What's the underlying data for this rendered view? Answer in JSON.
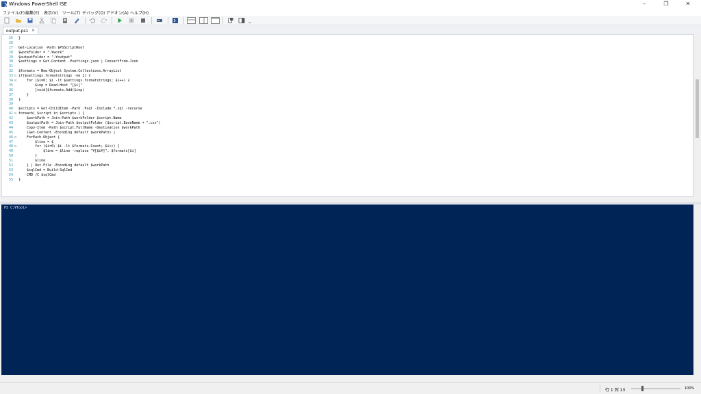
{
  "window": {
    "title": "Windows PowerShell ISE",
    "minimize": "–",
    "maximize": "❐",
    "close": "✕"
  },
  "menu": [
    "ファイル(F)",
    "編集(E)",
    "表示(V)",
    "ツール(T)",
    "デバッグ(D)",
    "アドオン(A)",
    "ヘルプ(H)"
  ],
  "tab": {
    "label": "output.ps1",
    "close": "✕"
  },
  "editor": {
    "lines": [
      {
        "n": "25",
        "fold": "",
        "text": "}"
      },
      {
        "n": "26",
        "fold": "",
        "text": ""
      },
      {
        "n": "27",
        "fold": "",
        "text": "Get-Location -Path $PSScriptRoot"
      },
      {
        "n": "28",
        "fold": "",
        "text": "$workFolder = \".¥work\""
      },
      {
        "n": "29",
        "fold": "",
        "text": "$outputFolder = \".¥output\""
      },
      {
        "n": "30",
        "fold": "",
        "text": "$settings = Get-Content .¥settings.json | ConvertFrom-Json"
      },
      {
        "n": "31",
        "fold": "",
        "text": ""
      },
      {
        "n": "32",
        "fold": "",
        "text": "$formats = New-Object System.Collections.ArrayList"
      },
      {
        "n": "33",
        "fold": "⊟",
        "text": "if($settings.formatstrings -ne 1) {"
      },
      {
        "n": "34",
        "fold": "⊟",
        "text": "    for ($i=0; $i -lt $settings.formatstrings; $i++) {"
      },
      {
        "n": "35",
        "fold": "",
        "text": "        $inp = Read-Host \"[$i]\""
      },
      {
        "n": "36",
        "fold": "",
        "text": "        [void]$formats.Add($inp)"
      },
      {
        "n": "37",
        "fold": "",
        "text": "    }"
      },
      {
        "n": "38",
        "fold": "",
        "text": "}"
      },
      {
        "n": "39",
        "fold": "",
        "text": ""
      },
      {
        "n": "40",
        "fold": "",
        "text": "$scripts = Get-ChildItem -Path .¥sql -Include *.sql -recurse"
      },
      {
        "n": "41",
        "fold": "⊟",
        "text": "foreach( $script in $scripts ) {"
      },
      {
        "n": "42",
        "fold": "",
        "text": "    $workPath = Join-Path $workFolder $script.Name"
      },
      {
        "n": "43",
        "fold": "",
        "text": "    $outputPath = Join-Path $outputFolder ($script.BaseName + \".csv\")"
      },
      {
        "n": "44",
        "fold": "",
        "text": "    Copy-Item -Path $script.FullName -Destination $workPath"
      },
      {
        "n": "45",
        "fold": "",
        "text": "    (Get-Content -Encoding default $workPath) |"
      },
      {
        "n": "46",
        "fold": "⊟",
        "text": "    ForEach-Object {"
      },
      {
        "n": "47",
        "fold": "",
        "text": "        $line = $_"
      },
      {
        "n": "48",
        "fold": "⊟",
        "text": "        for ($i=0; $i -lt $formats.Count; $i++) {"
      },
      {
        "n": "49",
        "fold": "",
        "text": "            $line = $line -replace \"¥[$i¥]\", $formats[$i]"
      },
      {
        "n": "50",
        "fold": "",
        "text": "        }"
      },
      {
        "n": "51",
        "fold": "",
        "text": "        $line"
      },
      {
        "n": "52",
        "fold": "",
        "text": "    } | Out-File -Encoding default $workPath"
      },
      {
        "n": "53",
        "fold": "",
        "text": "    $sqlCmd = Build-SqlCmd"
      },
      {
        "n": "54",
        "fold": "",
        "text": "    CMD /C $sqlCmd"
      },
      {
        "n": "55",
        "fold": "",
        "text": "}"
      }
    ]
  },
  "console": {
    "prompt": "PS C:¥Tool>"
  },
  "status": {
    "position": "行 1  列 13",
    "zoom": "100%"
  }
}
